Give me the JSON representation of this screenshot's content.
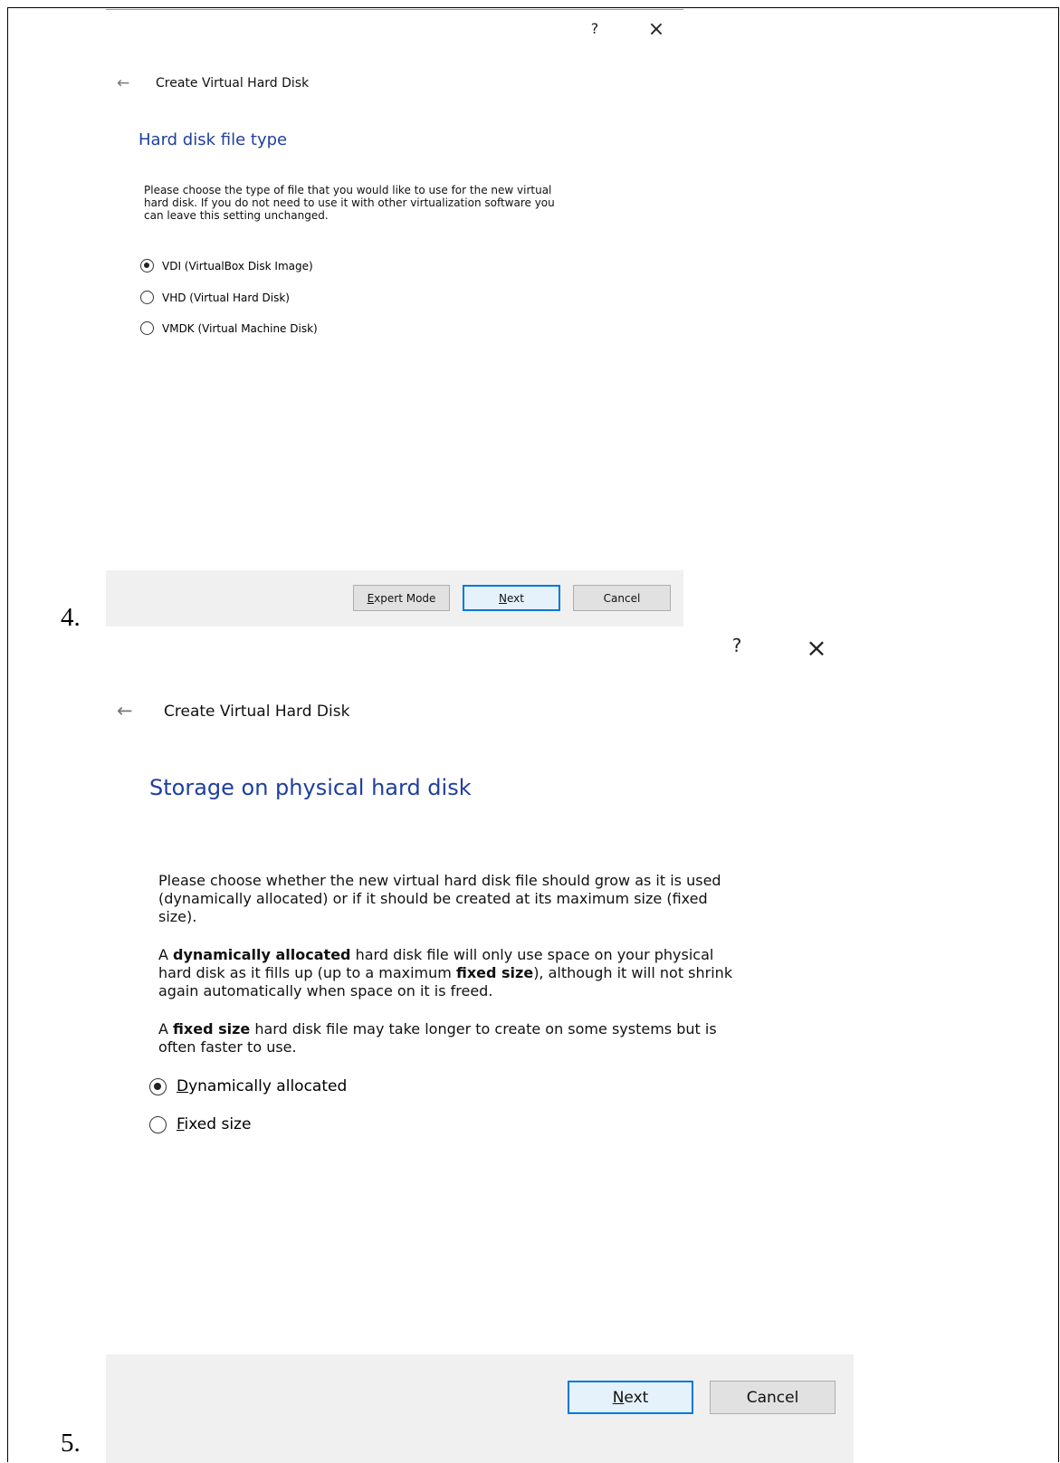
{
  "steps": {
    "first": "4.",
    "second": "5."
  },
  "dialog_a": {
    "help": "?",
    "close": "×",
    "back": "←",
    "title": "Create Virtual Hard Disk",
    "heading": "Hard disk file type",
    "description": [
      "Please choose the type of file that you would like to use for the new virtual",
      "hard disk. If you do not need to use it with other virtualization software you",
      "can leave this setting unchanged."
    ],
    "options": [
      {
        "label": "VDI (VirtualBox Disk Image)",
        "selected": true
      },
      {
        "label": "VHD (Virtual Hard Disk)",
        "selected": false
      },
      {
        "label": "VMDK (Virtual Machine Disk)",
        "selected": false
      }
    ],
    "buttons": {
      "expert_mnemonic": "E",
      "expert_rest": "xpert Mode",
      "next_mnemonic": "N",
      "next_rest": "ext",
      "cancel": "Cancel"
    }
  },
  "dialog_b": {
    "help": "?",
    "close": "×",
    "back": "←",
    "title": "Create Virtual Hard Disk",
    "heading": "Storage on physical hard disk",
    "para1": [
      "Please choose whether the new virtual hard disk file should grow as it is used",
      "(dynamically allocated) or if it should be created at its maximum size (fixed",
      "size)."
    ],
    "para2": {
      "l1_a": "A ",
      "l1_bold": "dynamically allocated",
      "l1_b": " hard disk file will only use space on your physical",
      "l2_a": "hard disk as it fills up (up to a maximum ",
      "l2_bold": "fixed size",
      "l2_b": "), although it will not shrink",
      "l3": "again automatically when space on it is freed."
    },
    "para3": {
      "l1_a": "A ",
      "l1_bold": "fixed size",
      "l1_b": " hard disk file may take longer to create on some systems but is",
      "l2": "often faster to use."
    },
    "options": [
      {
        "mnemonic": "D",
        "rest": "ynamically allocated",
        "selected": true
      },
      {
        "mnemonic": "F",
        "rest": "ixed size",
        "selected": false
      }
    ],
    "buttons": {
      "next_mnemonic": "N",
      "next_rest": "ext",
      "cancel": "Cancel"
    }
  },
  "colors": {
    "heading": "#1f3f9f",
    "default_button_border": "#0078d7",
    "footer": "#f0f0f0"
  }
}
